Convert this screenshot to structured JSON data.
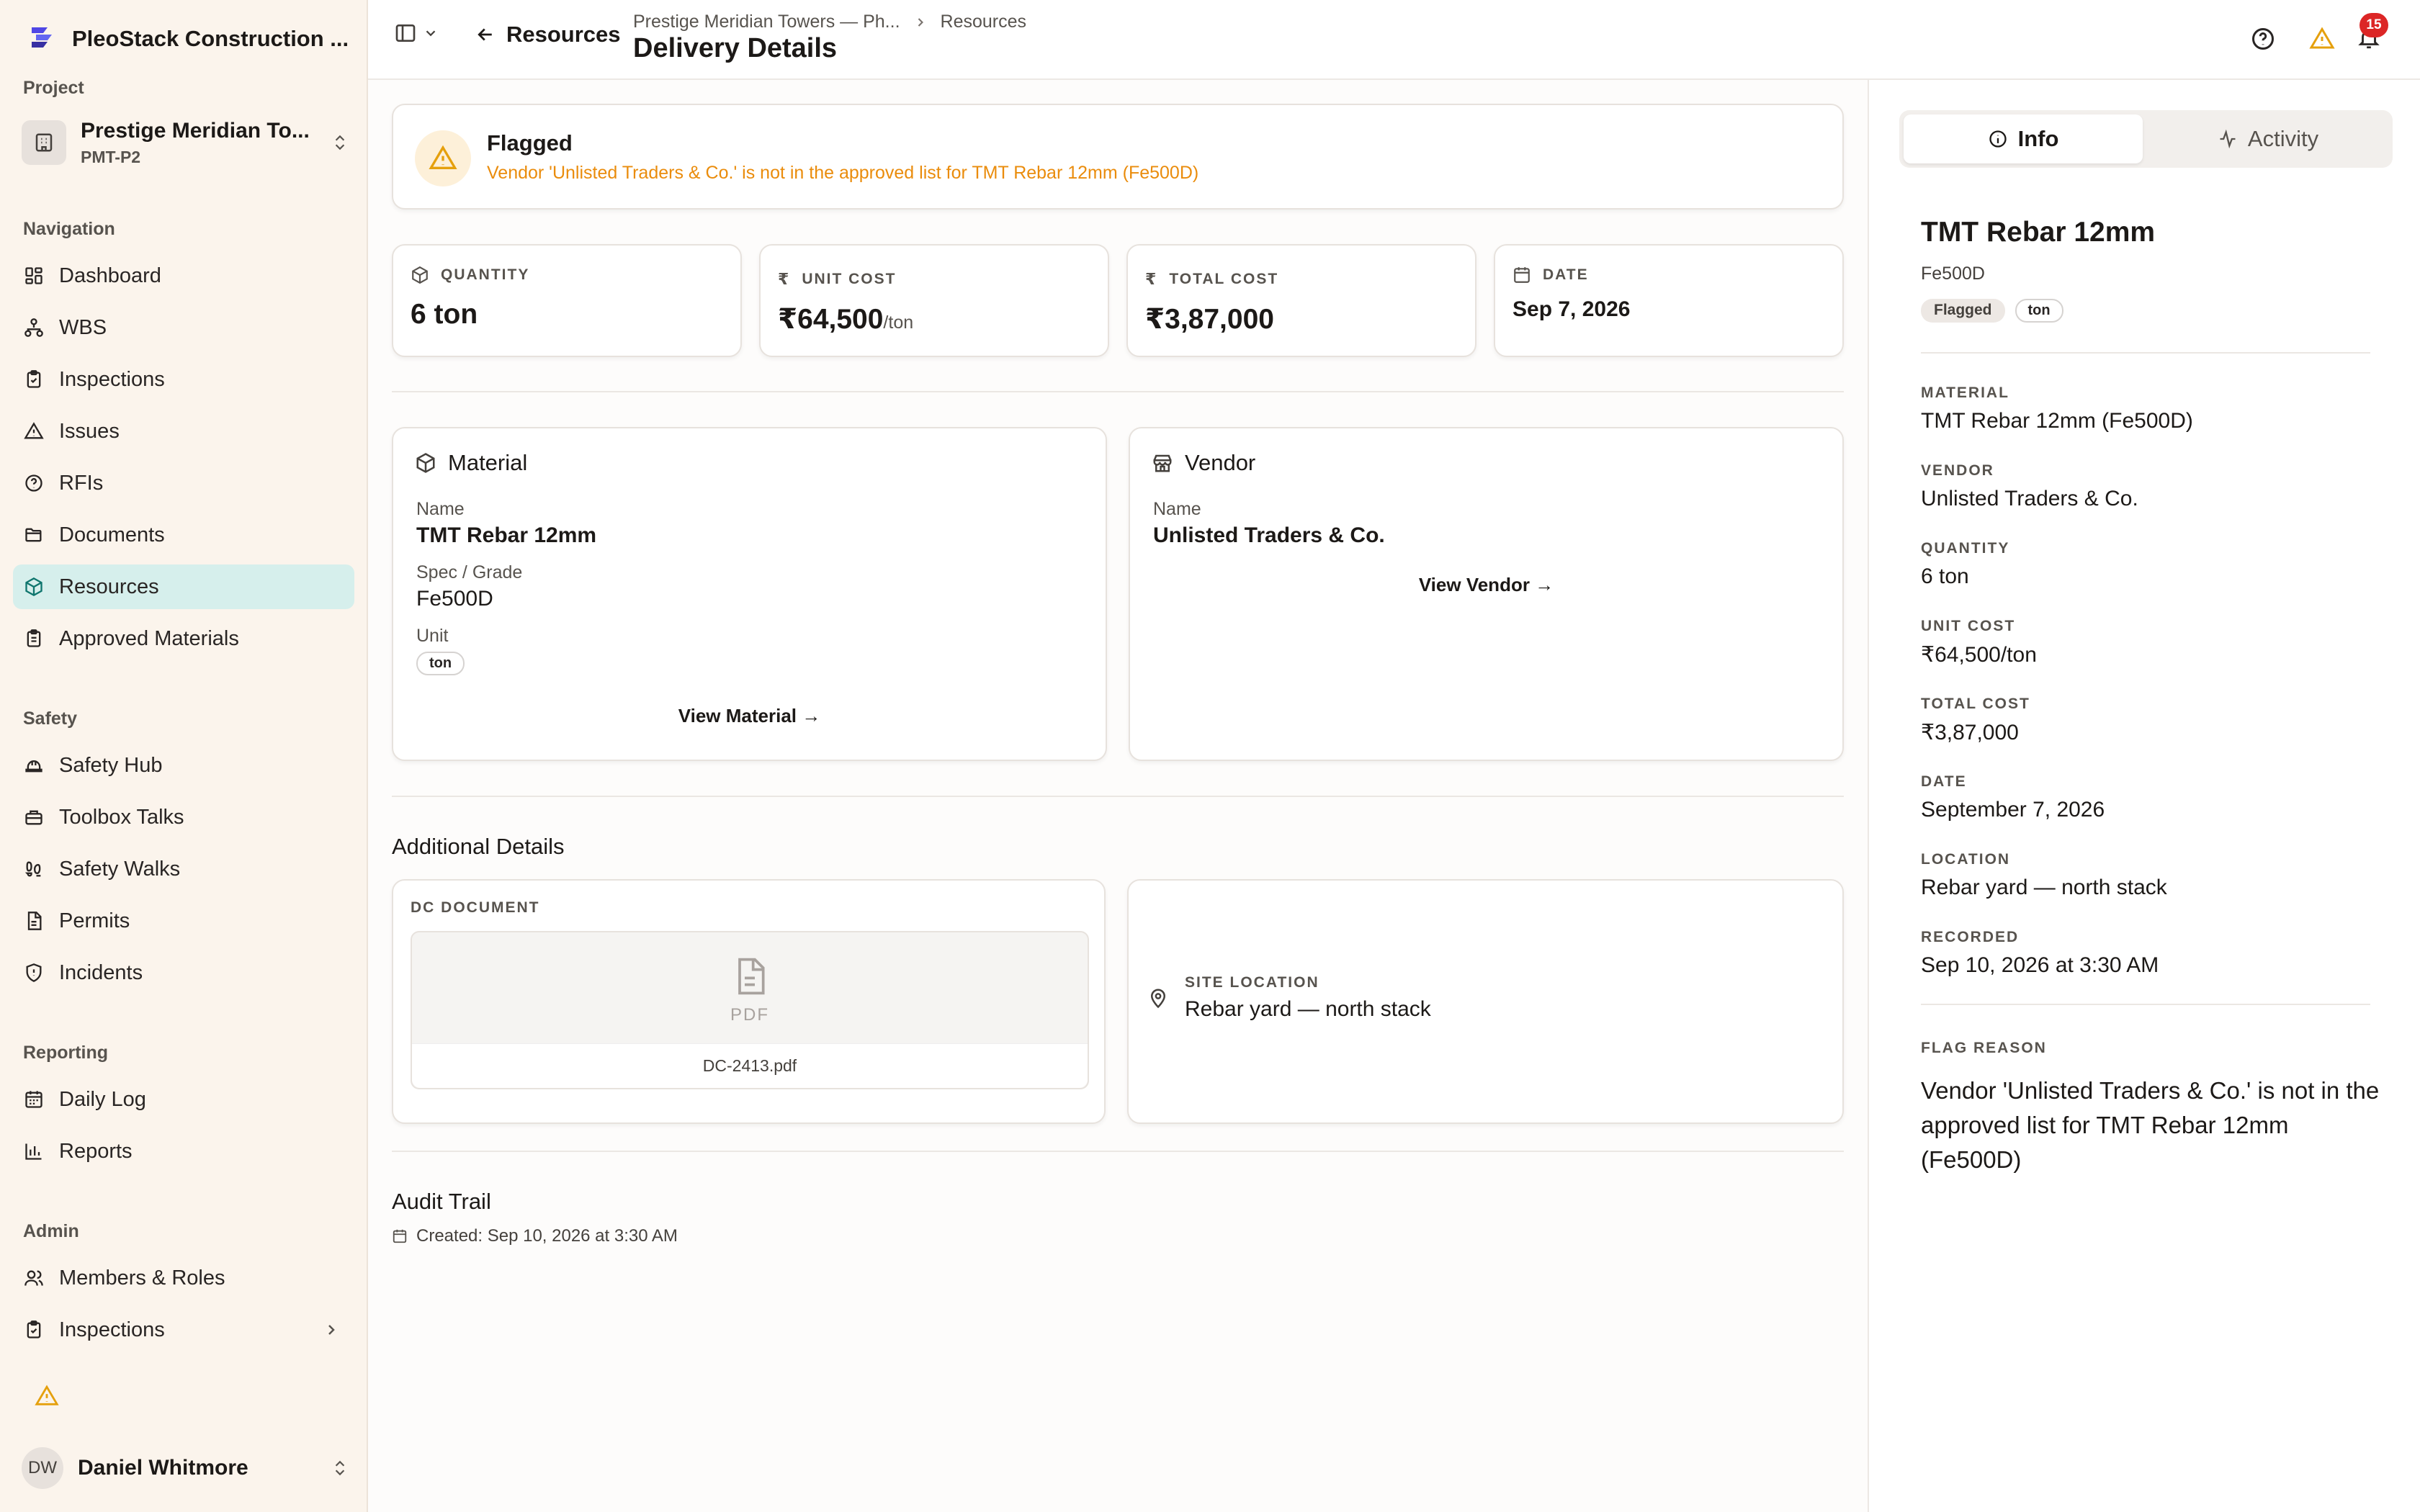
{
  "sidebar": {
    "brand": "PleoStack Construction ...",
    "project_section": "Project",
    "project_name": "Prestige Meridian To...",
    "project_code": "PMT-P2",
    "sections": {
      "navigation": "Navigation",
      "safety": "Safety",
      "reporting": "Reporting",
      "admin": "Admin"
    },
    "items": [
      {
        "label": "Dashboard",
        "icon": "dashboard-icon"
      },
      {
        "label": "WBS",
        "icon": "hierarchy-icon"
      },
      {
        "label": "Inspections",
        "icon": "clipboard-check-icon"
      },
      {
        "label": "Issues",
        "icon": "warning-triangle-icon"
      },
      {
        "label": "RFIs",
        "icon": "help-circle-icon"
      },
      {
        "label": "Documents",
        "icon": "folder-icon"
      },
      {
        "label": "Resources",
        "icon": "package-icon",
        "active": true
      },
      {
        "label": "Approved Materials",
        "icon": "clipboard-list-icon"
      },
      {
        "label": "Safety Hub",
        "icon": "hard-hat-icon"
      },
      {
        "label": "Toolbox Talks",
        "icon": "toolbox-icon"
      },
      {
        "label": "Safety Walks",
        "icon": "footprints-icon"
      },
      {
        "label": "Permits",
        "icon": "file-icon"
      },
      {
        "label": "Incidents",
        "icon": "shield-alert-icon"
      },
      {
        "label": "Daily Log",
        "icon": "calendar-icon"
      },
      {
        "label": "Reports",
        "icon": "bar-chart-icon"
      },
      {
        "label": "Members & Roles",
        "icon": "users-icon"
      },
      {
        "label": "Inspections",
        "icon": "clipboard-check-icon"
      }
    ],
    "user": {
      "initials": "DW",
      "name": "Daniel Whitmore"
    }
  },
  "header": {
    "back_label": "Resources",
    "breadcrumb": [
      "Prestige Meridian Towers — Ph...",
      "Resources"
    ],
    "title": "Delivery Details",
    "notification_count": "15"
  },
  "flag": {
    "title": "Flagged",
    "message": "Vendor 'Unlisted Traders & Co.' is not in the approved list for TMT Rebar 12mm (Fe500D)"
  },
  "stats": {
    "quantity": {
      "label": "QUANTITY",
      "value": "6 ton"
    },
    "unit_cost": {
      "label": "UNIT COST",
      "value": "₹64,500",
      "unit": "/ton"
    },
    "total_cost": {
      "label": "TOTAL COST",
      "value": "₹3,87,000"
    },
    "date": {
      "label": "DATE",
      "value": "Sep 7, 2026"
    }
  },
  "material": {
    "title": "Material",
    "name_label": "Name",
    "name": "TMT Rebar 12mm",
    "spec_label": "Spec / Grade",
    "spec": "Fe500D",
    "unit_label": "Unit",
    "unit": "ton",
    "link": "View Material →"
  },
  "vendor": {
    "title": "Vendor",
    "name_label": "Name",
    "name": "Unlisted Traders & Co.",
    "link": "View Vendor →"
  },
  "additional": {
    "heading": "Additional Details",
    "doc_label": "DC DOCUMENT",
    "pdf_text": "PDF",
    "file_name": "DC-2413.pdf",
    "site_label": "SITE LOCATION",
    "site_value": "Rebar yard — north stack"
  },
  "audit": {
    "heading": "Audit Trail",
    "created": "Created: Sep 10, 2026 at 3:30 AM"
  },
  "panel": {
    "tabs": {
      "info": "Info",
      "activity": "Activity"
    },
    "title": "TMT Rebar 12mm",
    "subtitle": "Fe500D",
    "chips": [
      "Flagged",
      "ton"
    ],
    "fields": [
      {
        "label": "MATERIAL",
        "value": "TMT Rebar 12mm (Fe500D)"
      },
      {
        "label": "VENDOR",
        "value": "Unlisted Traders & Co."
      },
      {
        "label": "QUANTITY",
        "value": "6 ton"
      },
      {
        "label": "UNIT COST",
        "value": "₹64,500/ton"
      },
      {
        "label": "TOTAL COST",
        "value": "₹3,87,000"
      },
      {
        "label": "DATE",
        "value": "September 7, 2026"
      },
      {
        "label": "LOCATION",
        "value": "Rebar yard — north stack"
      },
      {
        "label": "RECORDED",
        "value": "Sep 10, 2026 at 3:30 AM"
      }
    ],
    "flag_reason_label": "FLAG REASON",
    "flag_reason": "Vendor 'Unlisted Traders & Co.' is not in the approved list for TMT Rebar 12mm (Fe500D)"
  },
  "colors": {
    "accent": "#d6efec",
    "warning": "#ea8c0c",
    "danger": "#dc2626"
  }
}
